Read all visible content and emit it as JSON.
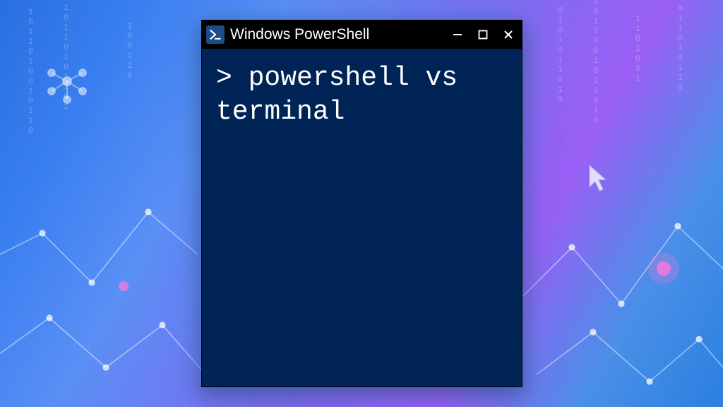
{
  "window": {
    "title": "Windows PowerShell",
    "icon_name": "powershell-icon"
  },
  "controls": {
    "minimize_label": "Minimize",
    "maximize_label": "Maximize",
    "close_label": "Close"
  },
  "terminal": {
    "prompt": ">",
    "command_text": "powershell vs terminal",
    "full_line": "> powershell vs terminal"
  },
  "colors": {
    "console_bg": "#012456",
    "titlebar_bg": "#000000",
    "text": "#ffffff",
    "icon_bg": "#1b4d8a"
  }
}
